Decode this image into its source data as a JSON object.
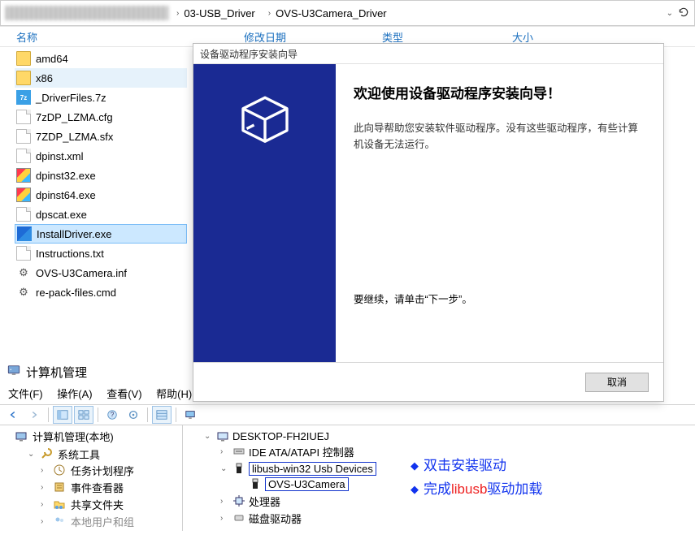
{
  "breadcrumb": {
    "seg1": "03-USB_Driver",
    "seg2": "OVS-U3Camera_Driver"
  },
  "explorer": {
    "headers": {
      "name": "名称",
      "date": "修改日期",
      "type": "类型",
      "size": "大小"
    },
    "files": [
      {
        "icon": "folder",
        "name": "amd64"
      },
      {
        "icon": "folder",
        "name": "x86",
        "light": true
      },
      {
        "icon": "7z",
        "name": "_DriverFiles.7z"
      },
      {
        "icon": "file",
        "name": "7zDP_LZMA.cfg"
      },
      {
        "icon": "file",
        "name": "7ZDP_LZMA.sfx"
      },
      {
        "icon": "file",
        "name": "dpinst.xml"
      },
      {
        "icon": "exe-color",
        "name": "dpinst32.exe"
      },
      {
        "icon": "exe-color",
        "name": "dpinst64.exe"
      },
      {
        "icon": "file",
        "name": "dpscat.exe"
      },
      {
        "icon": "exe-sel",
        "name": "InstallDriver.exe",
        "selected": true
      },
      {
        "icon": "txt",
        "name": "Instructions.txt"
      },
      {
        "icon": "inf",
        "name": "OVS-U3Camera.inf",
        "gear": true
      },
      {
        "icon": "cmd",
        "name": "re-pack-files.cmd",
        "gear": true
      }
    ]
  },
  "wizard": {
    "title": "设备驱动程序安装向导",
    "heading": "欢迎使用设备驱动程序安装向导！",
    "body1": "此向导帮助您安装软件驱动程序。没有这些驱动程序，有些计算机设备无法运行。",
    "continue": "要继续，请单击“下一步”。",
    "cancel": "取消"
  },
  "mmc": {
    "title": "计算机管理",
    "menu": {
      "file": "文件(F)",
      "action": "操作(A)",
      "view": "查看(V)",
      "help": "帮助(H)"
    },
    "tree": {
      "root": "计算机管理(本地)",
      "systools": "系统工具",
      "tasksched": "任务计划程序",
      "eventviewer": "事件查看器",
      "shared": "共享文件夹",
      "cutoff": "本地用户和组"
    },
    "dev": {
      "computer": "DESKTOP-FH2IUEJ",
      "ide": "IDE ATA/ATAPI 控制器",
      "libusb": "libusb-win32 Usb Devices",
      "ovs": "OVS-U3Camera",
      "cpu": "处理器",
      "cutoff": "磁盘驱动器"
    }
  },
  "annotations": {
    "line1a": "双击安装驱动",
    "line2a": "完成",
    "line2b": "libusb",
    "line2c": "驱动加载"
  }
}
